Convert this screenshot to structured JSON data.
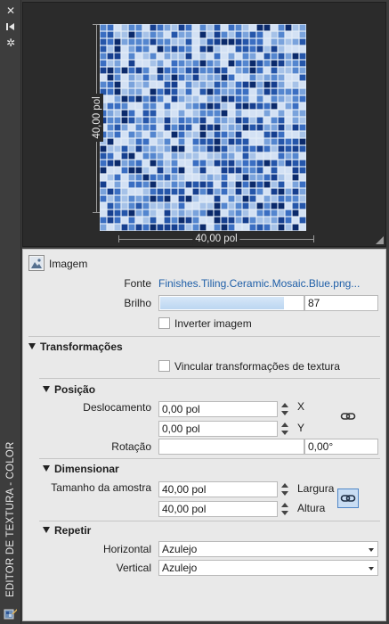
{
  "window": {
    "title": "EDITOR DE TEXTURA - COLOR",
    "icons": [
      "close-icon",
      "pin-icon",
      "settings-icon",
      "texture-editor-icon"
    ]
  },
  "preview": {
    "width_label": "40,00 pol",
    "height_label": "40,00 pol",
    "tile_colors": [
      "#0b2a6b",
      "#163f8f",
      "#2556aa",
      "#3a6ec2",
      "#5486cf",
      "#7aa3dc",
      "#a6c2e8",
      "#d3e1f4"
    ]
  },
  "image_section": {
    "title": "Imagem",
    "source_label": "Fonte",
    "source_value": "Finishes.Tiling.Ceramic.Mosaic.Blue.png...",
    "brightness_label": "Brilho",
    "brightness_value": "87",
    "brightness_fraction": 0.87,
    "invert_label": "Inverter imagem",
    "invert_checked": false
  },
  "transforms": {
    "title": "Transformações",
    "link_label": "Vincular transformações de textura",
    "link_checked": false
  },
  "position": {
    "title": "Posição",
    "offset_label": "Deslocamento",
    "offset_x": "0,00 pol",
    "offset_y": "0,00 pol",
    "axis_x": "X",
    "axis_y": "Y",
    "rotation_label": "Rotação",
    "rotation_value": "0,00°",
    "rotation_slider_fraction": 0
  },
  "scale": {
    "title": "Dimensionar",
    "sample_size_label": "Tamanho da amostra",
    "width_value": "40,00 pol",
    "height_value": "40,00 pol",
    "width_label": "Largura",
    "height_label": "Altura",
    "lock_active": true
  },
  "repeat": {
    "title": "Repetir",
    "horizontal_label": "Horizontal",
    "horizontal_value": "Azulejo",
    "vertical_label": "Vertical",
    "vertical_value": "Azulejo"
  }
}
